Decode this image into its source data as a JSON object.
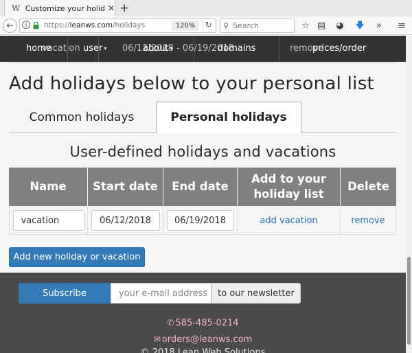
{
  "browser": {
    "tab_title": "Customize your holid…",
    "favicon": "W",
    "close_glyph": "✕",
    "newtab_glyph": "+",
    "url_prefix": "https://",
    "url_domain": "leanws.com",
    "url_path": "/holidays",
    "zoom": "120%",
    "search_placeholder": "Search"
  },
  "site_nav": {
    "ghost_items": [
      "vacation",
      "06/12/2018 - 06/19/2018",
      "remove"
    ],
    "items": [
      {
        "label": "home"
      },
      {
        "label": "user",
        "caret": "▾"
      },
      {
        "label": "about",
        "caret": "▾"
      },
      {
        "label": "domains"
      },
      {
        "label": "prices/order"
      }
    ]
  },
  "page": {
    "title": "Add holidays below to your personal list",
    "tabs": [
      "Common holidays",
      "Personal holidays"
    ],
    "active_tab": "Personal holidays",
    "section_title": "User-defined holidays and vacations"
  },
  "table": {
    "headers": [
      "Name",
      "Start date",
      "End date",
      "Add to your holiday list",
      "Delete"
    ],
    "rows": [
      {
        "name": "vacation",
        "start": "06/12/2018",
        "end": "06/19/2018",
        "add": "add vacation",
        "delete": "remove"
      }
    ]
  },
  "add_button": "Add new holiday or vacation",
  "footer": {
    "subscribe": "Subscribe",
    "email_placeholder": "your e-mail address",
    "newsletter": "to our newsletter",
    "phone": "585-485-0214",
    "email": "orders@leanws.com",
    "copyright": "© 2018 Lean Web Solutions"
  },
  "colors": {
    "nav_bg": "#333333",
    "header_bg": "#808080",
    "primary": "#337ab7",
    "footer_bg": "#4a4a4a",
    "footer_contact": "#f2b6c6"
  }
}
